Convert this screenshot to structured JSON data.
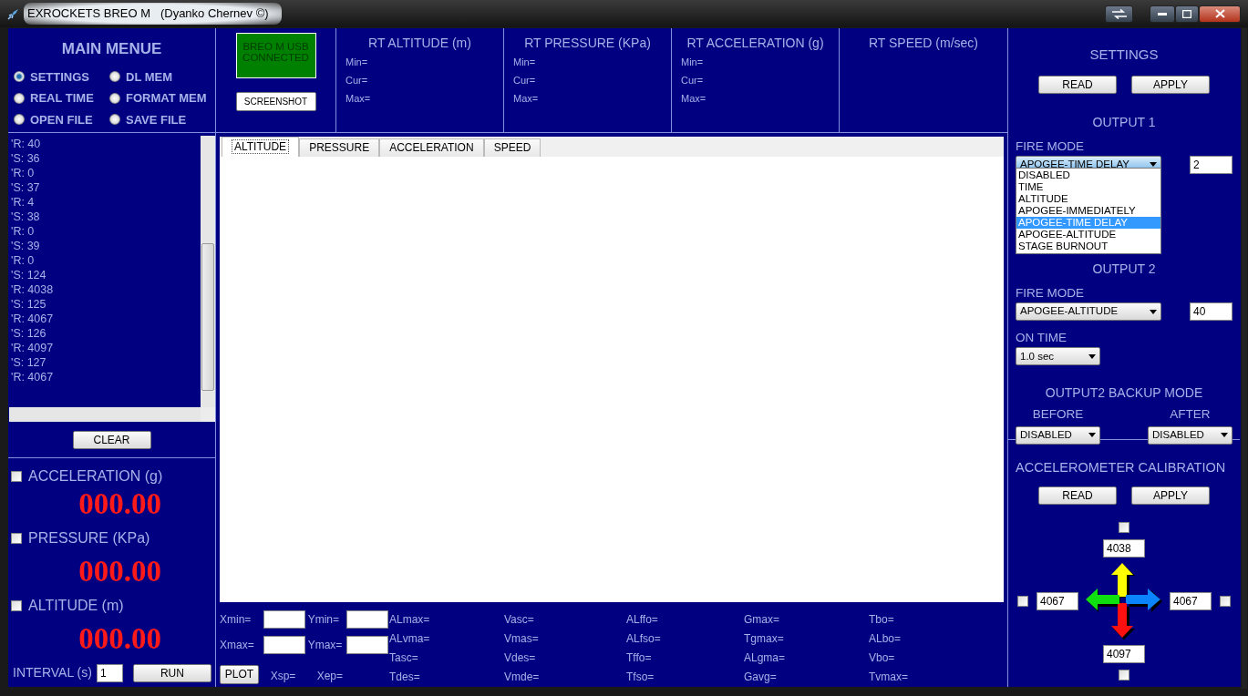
{
  "window": {
    "title": "EXROCKETS BREO M   (Dyanko Chernev ©)"
  },
  "main_menu": {
    "title": "MAIN MENUE",
    "options": [
      {
        "label": "SETTINGS",
        "selected": true
      },
      {
        "label": "DL MEM",
        "selected": false
      },
      {
        "label": "REAL TIME",
        "selected": false
      },
      {
        "label": "FORMAT MEM",
        "selected": false
      },
      {
        "label": "OPEN FILE",
        "selected": false
      },
      {
        "label": "SAVE FILE",
        "selected": false
      }
    ]
  },
  "connection": {
    "status": "BREO M USB CONNECTED",
    "connected": true
  },
  "screenshot_button": "SCREENSHOT",
  "rt_panels": [
    {
      "title": "RT ALTITUDE (m)",
      "rows": [
        "Min=",
        "Cur=",
        "Max="
      ]
    },
    {
      "title": "RT PRESSURE (KPa)",
      "rows": [
        "Min=",
        "Cur=",
        "Max="
      ]
    },
    {
      "title": "RT ACCELERATION (g)",
      "rows": [
        "Min=",
        "Cur=",
        "Max="
      ]
    },
    {
      "title": "RT SPEED (m/sec)"
    }
  ],
  "log": {
    "lines": [
      "'R: 40",
      "'S: 36",
      "'R: 0",
      "'S: 37",
      "'R: 4",
      "'S: 38",
      "'R: 0",
      "'S: 39",
      "'R: 0",
      "'S: 124",
      "'R: 4038",
      "'S: 125",
      "'R: 4067",
      "'S: 126",
      "'R: 4097",
      "'S: 127",
      "'R: 4067"
    ]
  },
  "clear_button": "CLEAR",
  "readouts": [
    {
      "label": "ACCELERATION (g)",
      "checked": false,
      "value": "000.00"
    },
    {
      "label": "PRESSURE (KPa)",
      "checked": false,
      "value": "000.00"
    },
    {
      "label": "ALTITUDE (m)",
      "checked": false,
      "value": "000.00"
    }
  ],
  "interval": {
    "label": "INTERVAL (s)",
    "value": "1"
  },
  "run_button": "RUN",
  "tabs": [
    {
      "label": "ALTITUDE",
      "selected": true
    },
    {
      "label": "PRESSURE",
      "selected": false
    },
    {
      "label": "ACCELERATION",
      "selected": false
    },
    {
      "label": "SPEED",
      "selected": false
    }
  ],
  "plot_controls": {
    "fields": [
      {
        "label": "Xmin="
      },
      {
        "label": "Ymin="
      },
      {
        "label": "Xmax="
      },
      {
        "label": "Ymax="
      }
    ],
    "plot_button": "PLOT",
    "markers": [
      "Xsp=",
      "Xep="
    ]
  },
  "stats": {
    "columns": [
      [
        "ALmax=",
        "ALvma=",
        "Tasc=",
        "Tdes="
      ],
      [
        "Vasc=",
        "Vmas=",
        "Vdes=",
        "Vmde="
      ],
      [
        "ALffo=",
        "ALfso=",
        "Tffo=",
        "Tfso="
      ],
      [
        "Gmax=",
        "Tgmax=",
        "ALgma=",
        "Gavg="
      ],
      [
        "Tbo=",
        "ALbo=",
        "Vbo=",
        "Tvmax="
      ]
    ]
  },
  "settings": {
    "title": "SETTINGS",
    "buttons": [
      "READ",
      "APPLY"
    ],
    "output1": {
      "title": "OUTPUT 1",
      "fire_mode_label": "FIRE MODE",
      "fire_mode": "APOGEE-TIME DELAY",
      "expanded": true,
      "param": "2",
      "options": [
        {
          "label": "DISABLED",
          "selected": false
        },
        {
          "label": "TIME",
          "selected": false
        },
        {
          "label": "ALTITUDE",
          "selected": false
        },
        {
          "label": "APOGEE-IMMEDIATELY",
          "selected": false
        },
        {
          "label": "APOGEE-TIME DELAY",
          "selected": true
        },
        {
          "label": "APOGEE-ALTITUDE",
          "selected": false
        },
        {
          "label": "STAGE BURNOUT",
          "selected": false
        }
      ]
    },
    "output2": {
      "title": "OUTPUT 2",
      "fire_mode_label": "FIRE MODE",
      "fire_mode": "APOGEE-ALTITUDE",
      "param": "40",
      "on_time_label": "ON TIME",
      "on_time": "1.0 sec"
    },
    "backup": {
      "title": "OUTPUT2 BACKUP MODE",
      "before_label": "BEFORE",
      "before": "DISABLED",
      "after_label": "AFTER",
      "after": "DISABLED"
    }
  },
  "calibration": {
    "title": "ACCELEROMETER CALIBRATION",
    "buttons": [
      "READ",
      "APPLY"
    ],
    "axes": [
      {
        "kind": "top",
        "value": "4038",
        "checked": false
      },
      {
        "kind": "left",
        "value": "4067",
        "checked": false
      },
      {
        "kind": "right",
        "value": "4067",
        "checked": false
      },
      {
        "kind": "bottom",
        "value": "4097",
        "checked": false
      }
    ]
  }
}
